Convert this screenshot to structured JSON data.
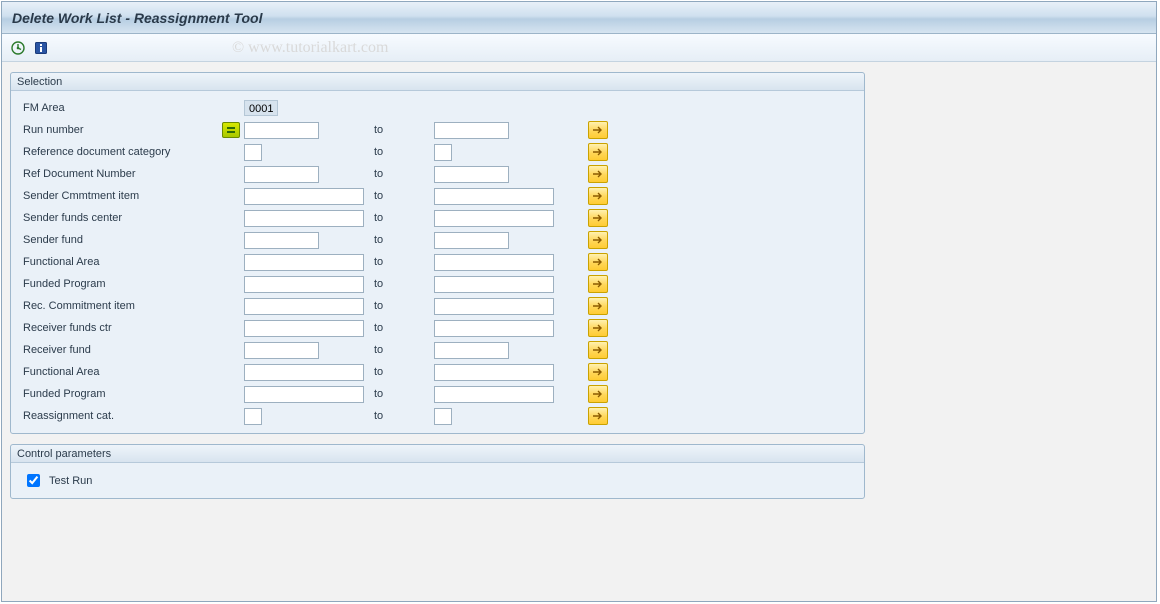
{
  "title": "Delete Work List - Reassignment Tool",
  "watermark": "© www.tutorialkart.com",
  "groups": {
    "selection": {
      "title": "Selection"
    },
    "control": {
      "title": "Control parameters"
    }
  },
  "to_label": "to",
  "fields": {
    "fm_area": {
      "label": "FM Area",
      "value": "0001"
    },
    "run_number": {
      "label": "Run number",
      "from": "",
      "to": ""
    },
    "ref_doc_cat": {
      "label": "Reference document category",
      "from": "",
      "to": ""
    },
    "ref_doc_num": {
      "label": "Ref Document Number",
      "from": "",
      "to": ""
    },
    "sender_cmmt_item": {
      "label": "Sender Cmmtment item",
      "from": "",
      "to": ""
    },
    "sender_funds_ctr": {
      "label": "Sender funds center",
      "from": "",
      "to": ""
    },
    "sender_fund": {
      "label": "Sender fund",
      "from": "",
      "to": ""
    },
    "functional_area_1": {
      "label": "Functional Area",
      "from": "",
      "to": ""
    },
    "funded_program_1": {
      "label": "Funded Program",
      "from": "",
      "to": ""
    },
    "rec_cmmt_item": {
      "label": "Rec. Commitment item",
      "from": "",
      "to": ""
    },
    "receiver_funds_ctr": {
      "label": "Receiver funds ctr",
      "from": "",
      "to": ""
    },
    "receiver_fund": {
      "label": "Receiver fund",
      "from": "",
      "to": ""
    },
    "functional_area_2": {
      "label": "Functional Area",
      "from": "",
      "to": ""
    },
    "funded_program_2": {
      "label": "Funded Program",
      "from": "",
      "to": ""
    },
    "reassignment_cat": {
      "label": "Reassignment cat.",
      "from": "",
      "to": ""
    }
  },
  "control": {
    "test_run": {
      "label": "Test Run",
      "checked": true
    }
  }
}
